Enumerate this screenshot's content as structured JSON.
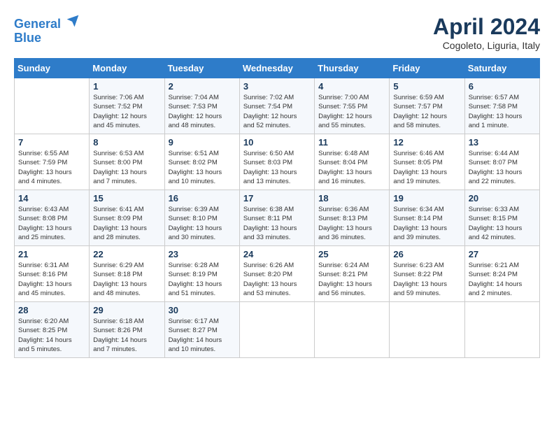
{
  "header": {
    "logo_line1": "General",
    "logo_line2": "Blue",
    "title": "April 2024",
    "location": "Cogoleto, Liguria, Italy"
  },
  "calendar": {
    "days_of_week": [
      "Sunday",
      "Monday",
      "Tuesday",
      "Wednesday",
      "Thursday",
      "Friday",
      "Saturday"
    ],
    "weeks": [
      [
        {
          "day": "",
          "info": ""
        },
        {
          "day": "1",
          "info": "Sunrise: 7:06 AM\nSunset: 7:52 PM\nDaylight: 12 hours\nand 45 minutes."
        },
        {
          "day": "2",
          "info": "Sunrise: 7:04 AM\nSunset: 7:53 PM\nDaylight: 12 hours\nand 48 minutes."
        },
        {
          "day": "3",
          "info": "Sunrise: 7:02 AM\nSunset: 7:54 PM\nDaylight: 12 hours\nand 52 minutes."
        },
        {
          "day": "4",
          "info": "Sunrise: 7:00 AM\nSunset: 7:55 PM\nDaylight: 12 hours\nand 55 minutes."
        },
        {
          "day": "5",
          "info": "Sunrise: 6:59 AM\nSunset: 7:57 PM\nDaylight: 12 hours\nand 58 minutes."
        },
        {
          "day": "6",
          "info": "Sunrise: 6:57 AM\nSunset: 7:58 PM\nDaylight: 13 hours\nand 1 minute."
        }
      ],
      [
        {
          "day": "7",
          "info": "Sunrise: 6:55 AM\nSunset: 7:59 PM\nDaylight: 13 hours\nand 4 minutes."
        },
        {
          "day": "8",
          "info": "Sunrise: 6:53 AM\nSunset: 8:00 PM\nDaylight: 13 hours\nand 7 minutes."
        },
        {
          "day": "9",
          "info": "Sunrise: 6:51 AM\nSunset: 8:02 PM\nDaylight: 13 hours\nand 10 minutes."
        },
        {
          "day": "10",
          "info": "Sunrise: 6:50 AM\nSunset: 8:03 PM\nDaylight: 13 hours\nand 13 minutes."
        },
        {
          "day": "11",
          "info": "Sunrise: 6:48 AM\nSunset: 8:04 PM\nDaylight: 13 hours\nand 16 minutes."
        },
        {
          "day": "12",
          "info": "Sunrise: 6:46 AM\nSunset: 8:05 PM\nDaylight: 13 hours\nand 19 minutes."
        },
        {
          "day": "13",
          "info": "Sunrise: 6:44 AM\nSunset: 8:07 PM\nDaylight: 13 hours\nand 22 minutes."
        }
      ],
      [
        {
          "day": "14",
          "info": "Sunrise: 6:43 AM\nSunset: 8:08 PM\nDaylight: 13 hours\nand 25 minutes."
        },
        {
          "day": "15",
          "info": "Sunrise: 6:41 AM\nSunset: 8:09 PM\nDaylight: 13 hours\nand 28 minutes."
        },
        {
          "day": "16",
          "info": "Sunrise: 6:39 AM\nSunset: 8:10 PM\nDaylight: 13 hours\nand 30 minutes."
        },
        {
          "day": "17",
          "info": "Sunrise: 6:38 AM\nSunset: 8:11 PM\nDaylight: 13 hours\nand 33 minutes."
        },
        {
          "day": "18",
          "info": "Sunrise: 6:36 AM\nSunset: 8:13 PM\nDaylight: 13 hours\nand 36 minutes."
        },
        {
          "day": "19",
          "info": "Sunrise: 6:34 AM\nSunset: 8:14 PM\nDaylight: 13 hours\nand 39 minutes."
        },
        {
          "day": "20",
          "info": "Sunrise: 6:33 AM\nSunset: 8:15 PM\nDaylight: 13 hours\nand 42 minutes."
        }
      ],
      [
        {
          "day": "21",
          "info": "Sunrise: 6:31 AM\nSunset: 8:16 PM\nDaylight: 13 hours\nand 45 minutes."
        },
        {
          "day": "22",
          "info": "Sunrise: 6:29 AM\nSunset: 8:18 PM\nDaylight: 13 hours\nand 48 minutes."
        },
        {
          "day": "23",
          "info": "Sunrise: 6:28 AM\nSunset: 8:19 PM\nDaylight: 13 hours\nand 51 minutes."
        },
        {
          "day": "24",
          "info": "Sunrise: 6:26 AM\nSunset: 8:20 PM\nDaylight: 13 hours\nand 53 minutes."
        },
        {
          "day": "25",
          "info": "Sunrise: 6:24 AM\nSunset: 8:21 PM\nDaylight: 13 hours\nand 56 minutes."
        },
        {
          "day": "26",
          "info": "Sunrise: 6:23 AM\nSunset: 8:22 PM\nDaylight: 13 hours\nand 59 minutes."
        },
        {
          "day": "27",
          "info": "Sunrise: 6:21 AM\nSunset: 8:24 PM\nDaylight: 14 hours\nand 2 minutes."
        }
      ],
      [
        {
          "day": "28",
          "info": "Sunrise: 6:20 AM\nSunset: 8:25 PM\nDaylight: 14 hours\nand 5 minutes."
        },
        {
          "day": "29",
          "info": "Sunrise: 6:18 AM\nSunset: 8:26 PM\nDaylight: 14 hours\nand 7 minutes."
        },
        {
          "day": "30",
          "info": "Sunrise: 6:17 AM\nSunset: 8:27 PM\nDaylight: 14 hours\nand 10 minutes."
        },
        {
          "day": "",
          "info": ""
        },
        {
          "day": "",
          "info": ""
        },
        {
          "day": "",
          "info": ""
        },
        {
          "day": "",
          "info": ""
        }
      ]
    ]
  }
}
